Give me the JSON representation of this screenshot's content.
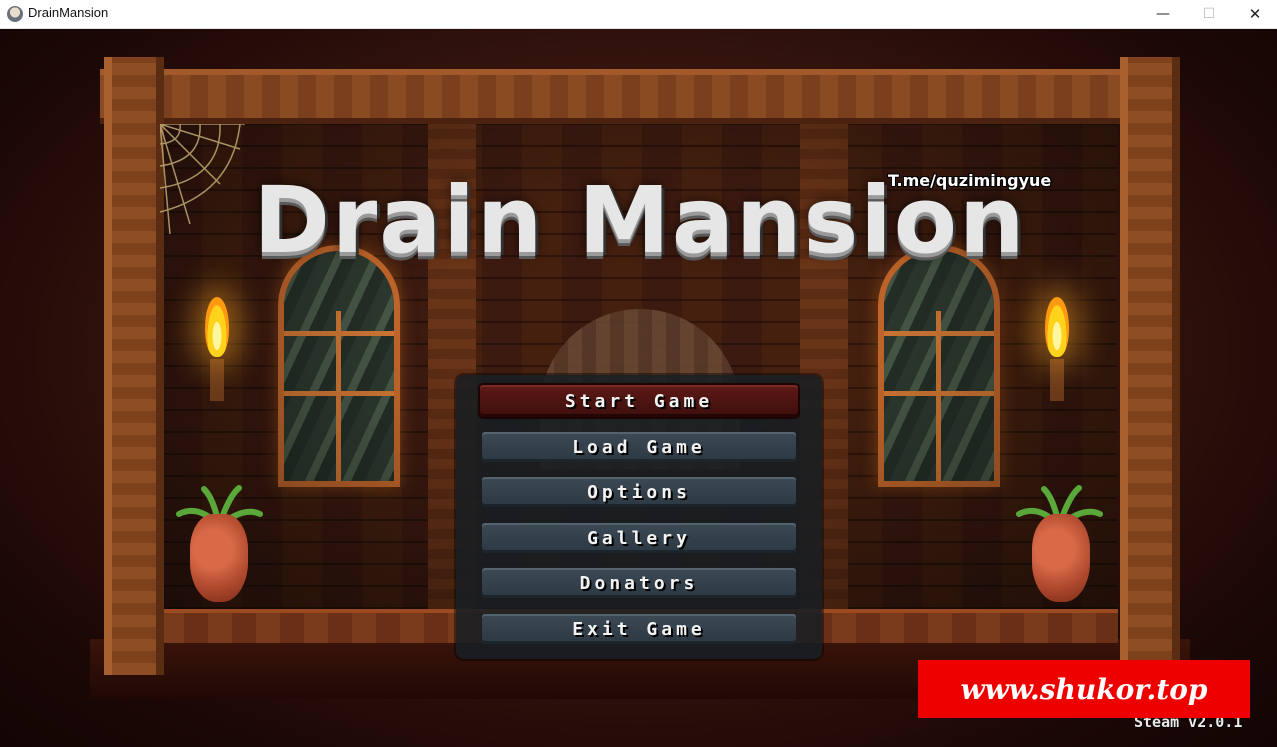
{
  "window": {
    "title": "DrainMansion",
    "minimize_glyph": "—",
    "maximize_glyph": "☐",
    "close_glyph": "✕"
  },
  "game": {
    "logo_text": "Drain Mansion",
    "telegram_watermark": "T.me/quzimingyue",
    "ad_banner_text": "www.shukor.top",
    "version_text": "Steam v2.0.1"
  },
  "menu": {
    "items": [
      {
        "label": "Start Game",
        "selected": true
      },
      {
        "label": "Load Game",
        "selected": false
      },
      {
        "label": "Options",
        "selected": false
      },
      {
        "label": "Gallery",
        "selected": false
      },
      {
        "label": "Donators",
        "selected": false
      },
      {
        "label": "Exit Game",
        "selected": false
      }
    ]
  },
  "colors": {
    "selected_button": "#5e1a16",
    "default_button": "#3c4a56",
    "ad_banner": "#ee0000",
    "torch_flame": "#ffd21c"
  }
}
